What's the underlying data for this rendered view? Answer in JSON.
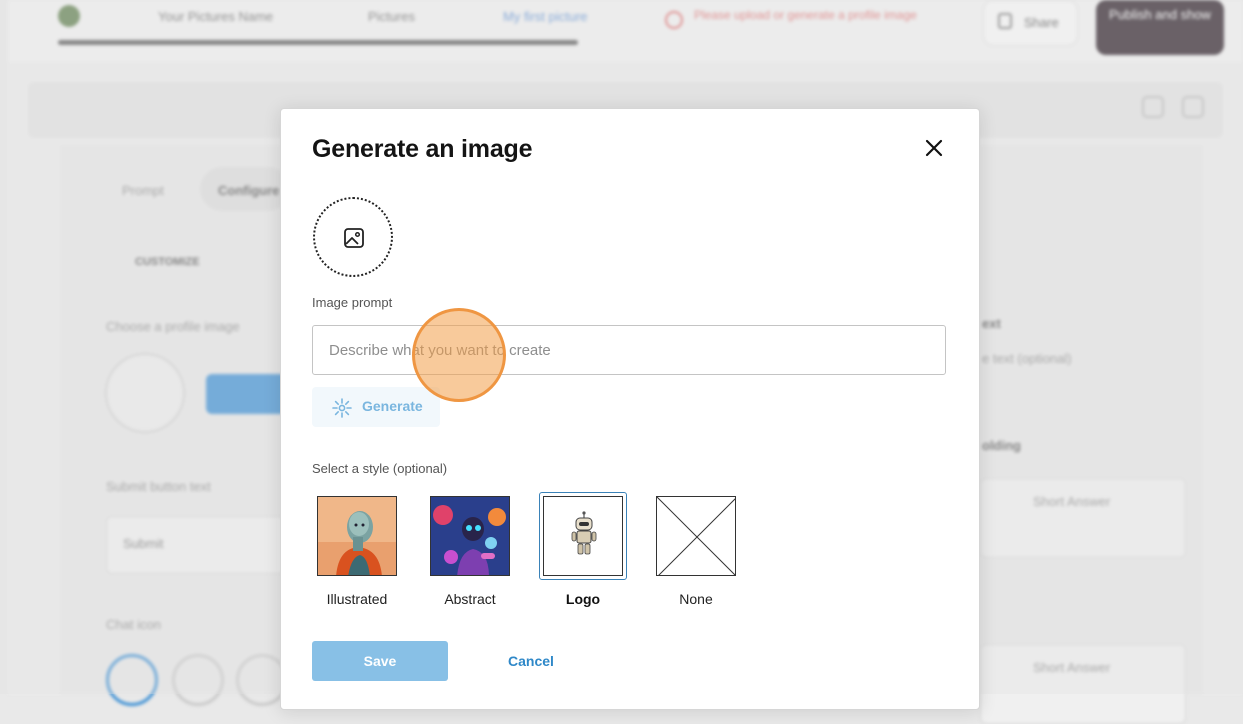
{
  "background": {
    "breadcrumbs": [
      "Your Pictures Name",
      "Pictures",
      "My first picture"
    ],
    "alert_text": "Please upload or generate a profile image",
    "share_label": "Share",
    "publish_label": "Publish and show",
    "tabs": [
      "Prompt",
      "Configure"
    ],
    "section_label": "CUSTOMIZE",
    "profile_label": "Choose a profile image",
    "submit_label": "Submit button text",
    "submit_value": "Submit",
    "chat_icon_label": "Chat icon",
    "right_heading_1": "ext",
    "right_sub_1": "e text (optional)",
    "right_heading_2": "olding",
    "short_answer": "Short Answer"
  },
  "modal": {
    "title": "Generate an image",
    "prompt_label": "Image prompt",
    "prompt_placeholder": "Describe what you want to create",
    "prompt_value": "",
    "generate_label": "Generate",
    "style_label": "Select a style (optional)",
    "styles": [
      {
        "name": "Illustrated",
        "selected": false
      },
      {
        "name": "Abstract",
        "selected": false
      },
      {
        "name": "Logo",
        "selected": true
      },
      {
        "name": "None",
        "selected": false
      }
    ],
    "save_label": "Save",
    "cancel_label": "Cancel"
  },
  "colors": {
    "accent": "#2f88c8",
    "save_disabled": "#88c0e6",
    "selected_ring": "#3a82b8",
    "click_marker": "#ef9642"
  },
  "icons": {
    "close": "close-icon",
    "image": "image-icon",
    "generate": "sparkle-icon"
  }
}
